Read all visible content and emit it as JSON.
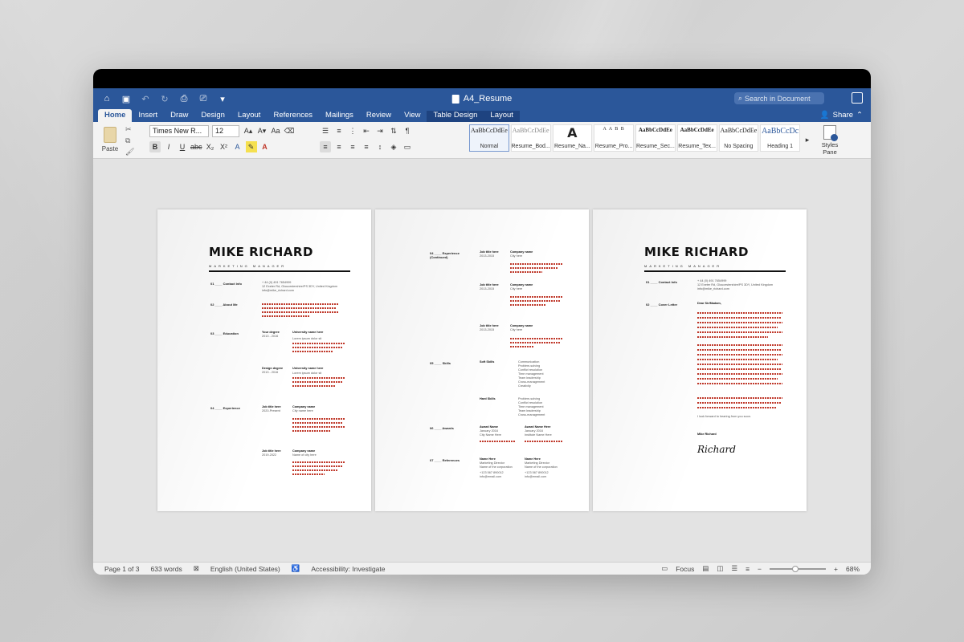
{
  "titlebar": {
    "document_title": "A4_Resume",
    "search_placeholder": "Search in Document",
    "icons": [
      "home-icon",
      "save-icon",
      "undo-icon",
      "redo-icon",
      "print-icon",
      "print-preview-icon",
      "customize-icon"
    ]
  },
  "tabs": [
    {
      "label": "Home",
      "active": true
    },
    {
      "label": "Insert"
    },
    {
      "label": "Draw"
    },
    {
      "label": "Design"
    },
    {
      "label": "Layout"
    },
    {
      "label": "References"
    },
    {
      "label": "Mailings"
    },
    {
      "label": "Review"
    },
    {
      "label": "View"
    },
    {
      "label": "Table Design",
      "context": true
    },
    {
      "label": "Layout",
      "context": true
    }
  ],
  "share_label": "Share",
  "ribbon": {
    "paste_label": "Paste",
    "font_name": "Times New R...",
    "font_size": "12",
    "styles_pane_label": "Styles Pane",
    "styles": [
      {
        "sample": "AaBbCcDdEe",
        "label": "Normal",
        "selected": true
      },
      {
        "sample": "AaBbCcDdEe",
        "label": "Resume_Bod..."
      },
      {
        "sample": "A",
        "label": "Resume_Na...",
        "big": true
      },
      {
        "sample": "A A B B",
        "label": "Resume_Pro..."
      },
      {
        "sample": "AaBbCcDdEe",
        "label": "Resume_Sec..."
      },
      {
        "sample": "AaBbCcDdEe",
        "label": "Resume_Tex..."
      },
      {
        "sample": "AaBbCcDdEe",
        "label": "No Spacing"
      },
      {
        "sample": "AaBbCcDc",
        "label": "Heading 1",
        "blue": true
      }
    ]
  },
  "pages": {
    "p1": {
      "name": "MIKE  RICHARD",
      "role": "MARKETING MANAGER",
      "sections": {
        "contact": "01 ____ Contact Info",
        "about": "02 ____ About Me",
        "education": "03 ____ Education",
        "experience": "04 ____ Experience"
      },
      "contact_lines": [
        "+ 44 (0) 491 7654999",
        "12 Exeter Rd, Gloucestershire/PS 3DY, United Kingdom",
        "info@mike_richard.com"
      ],
      "edu1_title": "Your degree",
      "edu1_years": "2013 - 2016",
      "edu1_school": "University name here",
      "edu2_title": "Design degree",
      "edu2_years": "2013 - 2016",
      "edu2_school": "University name here",
      "job1_title": "Job title here",
      "job1_years": "2020-Present",
      "job1_company": "Company name",
      "job1_city": "City name here",
      "job2_title": "Job title here",
      "job2_years": "2019-2022",
      "job2_company": "Company name",
      "job2_city": "Name of city here",
      "lorem": "Lorem ipsum dolor sit"
    },
    "p2": {
      "experience_cont": "04 ____ Experience",
      "continued": "(Continued)",
      "skills": "05 ____ Skills",
      "awards": "06 ____ Awards",
      "references": "07 ____ References",
      "job_title": "Job title here",
      "job_years": "2013-2015",
      "company": "Company name",
      "city": "City here",
      "soft_skills": "Soft Skills",
      "soft_list": [
        "Communication",
        "Problem-solving",
        "Conflict resolution",
        "Time management",
        "Team leadership",
        "Cross-management",
        "Creativity"
      ],
      "hard_skills": "Hard Skills",
      "hard_list": [
        "Problem-solving",
        "Conflict resolution",
        "Time management",
        "Team leadership",
        "Cross-management"
      ],
      "award1": "Award Name",
      "award1_date": "January 2016",
      "award1_city": "City Name Here",
      "award2": "Award Name Here",
      "award2_date": "January 2016",
      "award2_city": "Institute Name Here",
      "ref1_name": "Name Here",
      "ref1_role": "Marketing Director",
      "ref1_company": "Name of the corporation",
      "ref1_phone": "+123 567 890012",
      "ref1_email": "info@email.com",
      "ref2_name": "Name Here",
      "ref2_role": "Marketing Director",
      "ref2_company": "Name of the corporation",
      "ref2_phone": "+123 567 890012",
      "ref2_email": "info@email.com"
    },
    "p3": {
      "name": "MIKE  RICHARD",
      "role": "MARKETING MANAGER",
      "contact": "01 ____ Contact Info",
      "cover": "02 ____ Cover Letter",
      "contact_lines": [
        "+ 44 (0) 491 7654999",
        "12 Exeter Rd, Gloucestershire/PS 3DY, United Kingdom",
        "info@mike_richard.com"
      ],
      "greeting": "Dear Sir/Madam,",
      "closing": "I look forward to hearing from you soon.",
      "sign_name": "Mike Richard",
      "signature": "Richard"
    }
  },
  "status": {
    "page": "Page 1 of 3",
    "words": "633 words",
    "language": "English (United States)",
    "accessibility": "Accessibility: Investigate",
    "focus": "Focus",
    "zoom_minus": "−",
    "zoom_plus": "+",
    "zoom": "68%",
    "zoom_fraction": 0.45
  }
}
